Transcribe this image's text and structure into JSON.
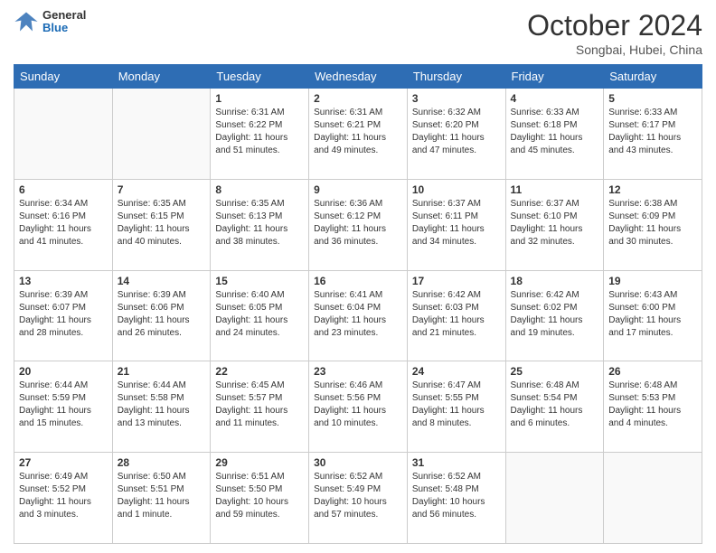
{
  "header": {
    "logo": {
      "general": "General",
      "blue": "Blue"
    },
    "title": "October 2024",
    "location": "Songbai, Hubei, China"
  },
  "weekdays": [
    "Sunday",
    "Monday",
    "Tuesday",
    "Wednesday",
    "Thursday",
    "Friday",
    "Saturday"
  ],
  "weeks": [
    [
      {
        "day": null
      },
      {
        "day": null
      },
      {
        "day": 1,
        "sunrise": "Sunrise: 6:31 AM",
        "sunset": "Sunset: 6:22 PM",
        "daylight": "Daylight: 11 hours and 51 minutes."
      },
      {
        "day": 2,
        "sunrise": "Sunrise: 6:31 AM",
        "sunset": "Sunset: 6:21 PM",
        "daylight": "Daylight: 11 hours and 49 minutes."
      },
      {
        "day": 3,
        "sunrise": "Sunrise: 6:32 AM",
        "sunset": "Sunset: 6:20 PM",
        "daylight": "Daylight: 11 hours and 47 minutes."
      },
      {
        "day": 4,
        "sunrise": "Sunrise: 6:33 AM",
        "sunset": "Sunset: 6:18 PM",
        "daylight": "Daylight: 11 hours and 45 minutes."
      },
      {
        "day": 5,
        "sunrise": "Sunrise: 6:33 AM",
        "sunset": "Sunset: 6:17 PM",
        "daylight": "Daylight: 11 hours and 43 minutes."
      }
    ],
    [
      {
        "day": 6,
        "sunrise": "Sunrise: 6:34 AM",
        "sunset": "Sunset: 6:16 PM",
        "daylight": "Daylight: 11 hours and 41 minutes."
      },
      {
        "day": 7,
        "sunrise": "Sunrise: 6:35 AM",
        "sunset": "Sunset: 6:15 PM",
        "daylight": "Daylight: 11 hours and 40 minutes."
      },
      {
        "day": 8,
        "sunrise": "Sunrise: 6:35 AM",
        "sunset": "Sunset: 6:13 PM",
        "daylight": "Daylight: 11 hours and 38 minutes."
      },
      {
        "day": 9,
        "sunrise": "Sunrise: 6:36 AM",
        "sunset": "Sunset: 6:12 PM",
        "daylight": "Daylight: 11 hours and 36 minutes."
      },
      {
        "day": 10,
        "sunrise": "Sunrise: 6:37 AM",
        "sunset": "Sunset: 6:11 PM",
        "daylight": "Daylight: 11 hours and 34 minutes."
      },
      {
        "day": 11,
        "sunrise": "Sunrise: 6:37 AM",
        "sunset": "Sunset: 6:10 PM",
        "daylight": "Daylight: 11 hours and 32 minutes."
      },
      {
        "day": 12,
        "sunrise": "Sunrise: 6:38 AM",
        "sunset": "Sunset: 6:09 PM",
        "daylight": "Daylight: 11 hours and 30 minutes."
      }
    ],
    [
      {
        "day": 13,
        "sunrise": "Sunrise: 6:39 AM",
        "sunset": "Sunset: 6:07 PM",
        "daylight": "Daylight: 11 hours and 28 minutes."
      },
      {
        "day": 14,
        "sunrise": "Sunrise: 6:39 AM",
        "sunset": "Sunset: 6:06 PM",
        "daylight": "Daylight: 11 hours and 26 minutes."
      },
      {
        "day": 15,
        "sunrise": "Sunrise: 6:40 AM",
        "sunset": "Sunset: 6:05 PM",
        "daylight": "Daylight: 11 hours and 24 minutes."
      },
      {
        "day": 16,
        "sunrise": "Sunrise: 6:41 AM",
        "sunset": "Sunset: 6:04 PM",
        "daylight": "Daylight: 11 hours and 23 minutes."
      },
      {
        "day": 17,
        "sunrise": "Sunrise: 6:42 AM",
        "sunset": "Sunset: 6:03 PM",
        "daylight": "Daylight: 11 hours and 21 minutes."
      },
      {
        "day": 18,
        "sunrise": "Sunrise: 6:42 AM",
        "sunset": "Sunset: 6:02 PM",
        "daylight": "Daylight: 11 hours and 19 minutes."
      },
      {
        "day": 19,
        "sunrise": "Sunrise: 6:43 AM",
        "sunset": "Sunset: 6:00 PM",
        "daylight": "Daylight: 11 hours and 17 minutes."
      }
    ],
    [
      {
        "day": 20,
        "sunrise": "Sunrise: 6:44 AM",
        "sunset": "Sunset: 5:59 PM",
        "daylight": "Daylight: 11 hours and 15 minutes."
      },
      {
        "day": 21,
        "sunrise": "Sunrise: 6:44 AM",
        "sunset": "Sunset: 5:58 PM",
        "daylight": "Daylight: 11 hours and 13 minutes."
      },
      {
        "day": 22,
        "sunrise": "Sunrise: 6:45 AM",
        "sunset": "Sunset: 5:57 PM",
        "daylight": "Daylight: 11 hours and 11 minutes."
      },
      {
        "day": 23,
        "sunrise": "Sunrise: 6:46 AM",
        "sunset": "Sunset: 5:56 PM",
        "daylight": "Daylight: 11 hours and 10 minutes."
      },
      {
        "day": 24,
        "sunrise": "Sunrise: 6:47 AM",
        "sunset": "Sunset: 5:55 PM",
        "daylight": "Daylight: 11 hours and 8 minutes."
      },
      {
        "day": 25,
        "sunrise": "Sunrise: 6:48 AM",
        "sunset": "Sunset: 5:54 PM",
        "daylight": "Daylight: 11 hours and 6 minutes."
      },
      {
        "day": 26,
        "sunrise": "Sunrise: 6:48 AM",
        "sunset": "Sunset: 5:53 PM",
        "daylight": "Daylight: 11 hours and 4 minutes."
      }
    ],
    [
      {
        "day": 27,
        "sunrise": "Sunrise: 6:49 AM",
        "sunset": "Sunset: 5:52 PM",
        "daylight": "Daylight: 11 hours and 3 minutes."
      },
      {
        "day": 28,
        "sunrise": "Sunrise: 6:50 AM",
        "sunset": "Sunset: 5:51 PM",
        "daylight": "Daylight: 11 hours and 1 minute."
      },
      {
        "day": 29,
        "sunrise": "Sunrise: 6:51 AM",
        "sunset": "Sunset: 5:50 PM",
        "daylight": "Daylight: 10 hours and 59 minutes."
      },
      {
        "day": 30,
        "sunrise": "Sunrise: 6:52 AM",
        "sunset": "Sunset: 5:49 PM",
        "daylight": "Daylight: 10 hours and 57 minutes."
      },
      {
        "day": 31,
        "sunrise": "Sunrise: 6:52 AM",
        "sunset": "Sunset: 5:48 PM",
        "daylight": "Daylight: 10 hours and 56 minutes."
      },
      {
        "day": null
      },
      {
        "day": null
      }
    ]
  ]
}
